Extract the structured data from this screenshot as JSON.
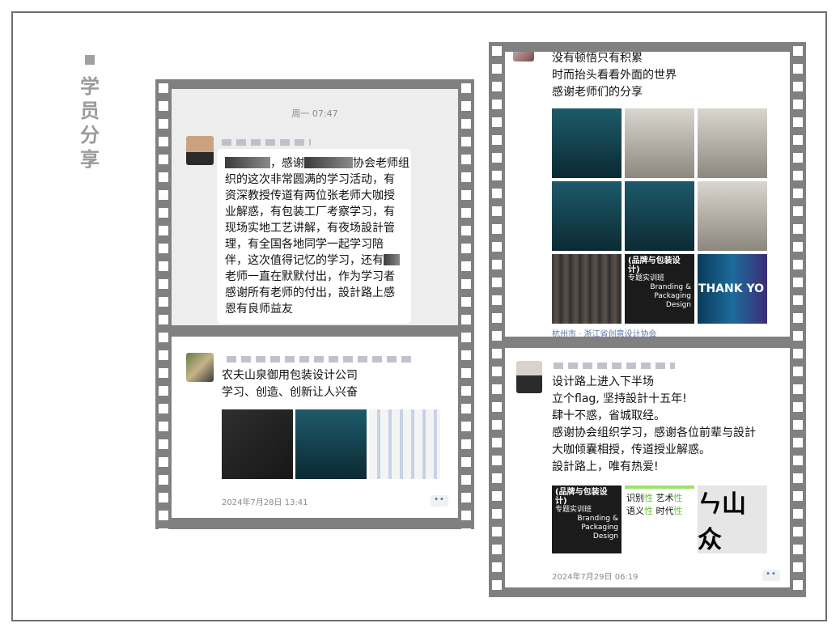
{
  "side_title": [
    "学",
    "员",
    "分",
    "享"
  ],
  "left_top": {
    "timestamp": "周一 07:47",
    "message_lines": [
      "，感谢",
      "协会老师组",
      "织的这次非常圆满的学习活动，有",
      "资深教授传道有两位张老师大咖授",
      "业解惑，有包装工厂考察学习，有",
      "现场实地工艺讲解，有夜场設計管",
      "理，有全国各地同学一起学习陪",
      "伴，这次值得记忆的学习，还有",
      "老师一直在默默付出，作为学习者",
      "感谢所有老师的付出，設計路上感",
      "恩有良师益友"
    ]
  },
  "left_bottom": {
    "text_lines": [
      "农夫山泉御用包装设计公司",
      "学习、创造、创新让人兴奋"
    ],
    "date": "2024年7月28日 13:41",
    "more": "••"
  },
  "right_top": {
    "text_lines": [
      "没有顿悟只有积累",
      "时而抬头看看外面的世界",
      "感谢老师们的分享"
    ],
    "location": "杭州市 · 浙江省创意设计协会",
    "photo_texts": {
      "course_title": "(品牌与包装设计)",
      "course_sub": "专题实训班",
      "course_en1": "Branding &",
      "course_en2": "Packaging",
      "course_en3": "Design",
      "thanks": "THANK YO"
    }
  },
  "right_bottom": {
    "text_lines": [
      "设计路上进入下半场",
      "立个flag, 坚持設計十五年!",
      "肆十不惑，省城取经。",
      "感谢协会组织学习，感谢各位前辈与設計",
      "大咖倾囊相授，传道授业解惑。",
      "設計路上，唯有热爱!"
    ],
    "photo_texts": {
      "course_title": "(品牌与包装设计)",
      "course_sub": "专题实训班",
      "course_en1": "Branding &",
      "course_en2": "Packaging",
      "course_en3": "Design",
      "words_row1_a": "识别",
      "words_row1_b": "性",
      "words_row1_c": "艺术",
      "words_row1_d": "性",
      "words_row2_a": "语义",
      "words_row2_b": "性",
      "words_row2_c": "时代",
      "words_row2_d": "性",
      "calligraphy": "ㄣ山众"
    },
    "date": "2024年7月29日 06:19",
    "more": "••"
  }
}
